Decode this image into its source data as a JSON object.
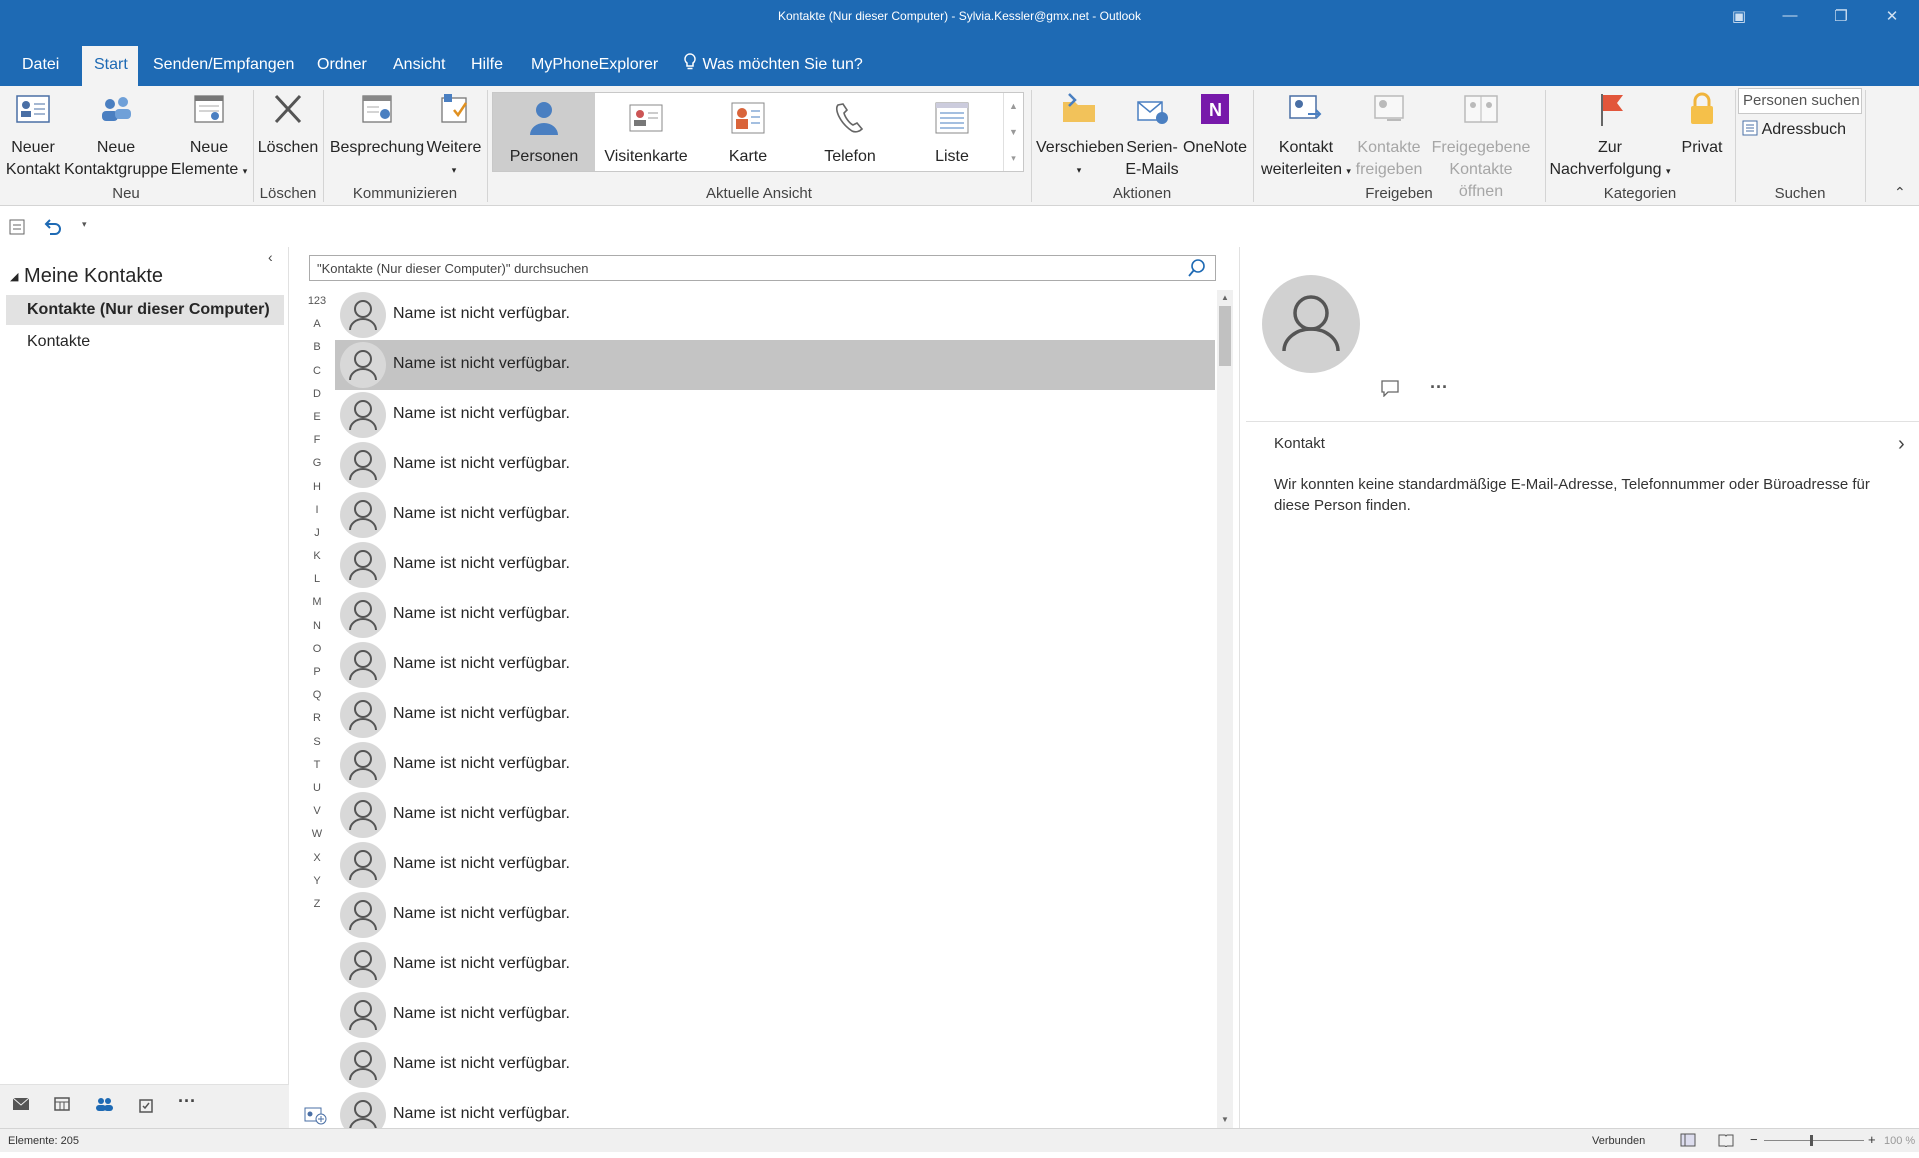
{
  "window": {
    "title": "Kontakte (Nur dieser Computer) - Sylvia.Kessler@gmx.net  -  Outlook",
    "controls": [
      "ribbon-display-icon",
      "minimize-icon",
      "restore-icon",
      "close-icon"
    ]
  },
  "menu": {
    "tabs": [
      "Datei",
      "Start",
      "Senden/Empfangen",
      "Ordner",
      "Ansicht",
      "Hilfe",
      "MyPhoneExplorer"
    ],
    "active": "Start",
    "tell_me": "Was möchten Sie tun?"
  },
  "ribbon": {
    "neu": {
      "label": "Neu",
      "neuer_kontakt": [
        "Neuer",
        "Kontakt"
      ],
      "neue_kontaktgruppe": [
        "Neue",
        "Kontaktgruppe"
      ],
      "neue_elemente": [
        "Neue",
        "Elemente"
      ]
    },
    "loeschen": {
      "label": "Löschen",
      "button": "Löschen"
    },
    "kommunizieren": {
      "label": "Kommunizieren",
      "besprechung": "Besprechung",
      "weitere": "Weitere"
    },
    "aktuelle_ansicht": {
      "label": "Aktuelle Ansicht",
      "views": [
        "Personen",
        "Visitenkarte",
        "Karte",
        "Telefon",
        "Liste"
      ],
      "active": "Personen"
    },
    "aktionen": {
      "label": "Aktionen",
      "verschieben": "Verschieben",
      "serien": [
        "Serien-",
        "E-Mails"
      ],
      "onenote": "OneNote"
    },
    "freigeben": {
      "label": "Freigeben",
      "weiterleiten": [
        "Kontakt",
        "weiterleiten"
      ],
      "kontakte_freigeben": [
        "Kontakte",
        "freigeben"
      ],
      "freigegebene": [
        "Freigegebene",
        "Kontakte öffnen"
      ]
    },
    "kategorien": {
      "label": "Kategorien",
      "nachverfolgung": [
        "Zur",
        "Nachverfolgung"
      ],
      "privat": "Privat"
    },
    "suchen": {
      "label": "Suchen",
      "personen_suchen": "Personen suchen",
      "adressbuch": "Adressbuch"
    }
  },
  "folder_pane": {
    "header": "Meine Kontakte",
    "items": [
      {
        "label": "Kontakte (Nur dieser Computer)",
        "selected": true
      },
      {
        "label": "Kontakte",
        "selected": false
      }
    ],
    "nav": [
      "mail-icon",
      "calendar-icon",
      "people-icon",
      "tasks-icon",
      "more-icon"
    ]
  },
  "list": {
    "search_placeholder": "\"Kontakte (Nur dieser Computer)\" durchsuchen",
    "alphabet": [
      "123",
      "A",
      "B",
      "C",
      "D",
      "E",
      "F",
      "G",
      "H",
      "I",
      "J",
      "K",
      "L",
      "M",
      "N",
      "O",
      "P",
      "Q",
      "R",
      "S",
      "T",
      "U",
      "V",
      "W",
      "X",
      "Y",
      "Z"
    ],
    "contacts": [
      "Name ist nicht verfügbar.",
      "Name ist nicht verfügbar.",
      "Name ist nicht verfügbar.",
      "Name ist nicht verfügbar.",
      "Name ist nicht verfügbar.",
      "Name ist nicht verfügbar.",
      "Name ist nicht verfügbar.",
      "Name ist nicht verfügbar.",
      "Name ist nicht verfügbar.",
      "Name ist nicht verfügbar.",
      "Name ist nicht verfügbar.",
      "Name ist nicht verfügbar.",
      "Name ist nicht verfügbar.",
      "Name ist nicht verfügbar.",
      "Name ist nicht verfügbar.",
      "Name ist nicht verfügbar.",
      "Name ist nicht verfügbar."
    ],
    "selected_index": 1
  },
  "reading_pane": {
    "section_title": "Kontakt",
    "message": "Wir konnten keine standardmäßige E-Mail-Adresse, Telefonnummer oder Büroadresse für diese Person finden."
  },
  "statusbar": {
    "items": "Elemente: 205",
    "connection": "Verbunden",
    "zoom": "100 %"
  },
  "colors": {
    "accent": "#1e6ab4",
    "selection": "#c4c4c4",
    "ribbon_bg": "#f3f3f3"
  }
}
